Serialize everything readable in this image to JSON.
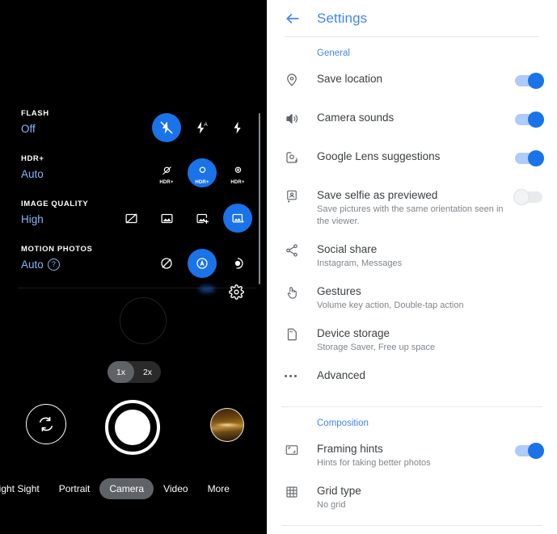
{
  "camera": {
    "quick_settings": [
      {
        "title": "FLASH",
        "value": "Off",
        "help": false,
        "options": [
          {
            "icon": "flash-off-icon",
            "selected": true,
            "sublabel": ""
          },
          {
            "icon": "flash-auto-icon",
            "selected": false,
            "sublabel": ""
          },
          {
            "icon": "flash-on-icon",
            "selected": false,
            "sublabel": ""
          }
        ]
      },
      {
        "title": "HDR+",
        "value": "Auto",
        "help": false,
        "options": [
          {
            "icon": "hdr-off-icon",
            "selected": false,
            "sublabel": "HDR+"
          },
          {
            "icon": "hdr-auto-icon",
            "selected": true,
            "sublabel": "HDR+"
          },
          {
            "icon": "hdr-enhanced-icon",
            "selected": false,
            "sublabel": "HDR+"
          }
        ]
      },
      {
        "title": "IMAGE QUALITY",
        "value": "High",
        "help": false,
        "options": [
          {
            "icon": "image-off-icon",
            "selected": false,
            "sublabel": ""
          },
          {
            "icon": "image-basic-icon",
            "selected": false,
            "sublabel": ""
          },
          {
            "icon": "image-plus-icon",
            "selected": false,
            "sublabel": ""
          },
          {
            "icon": "image-high-icon",
            "selected": true,
            "sublabel": ""
          }
        ]
      },
      {
        "title": "MOTION PHOTOS",
        "value": "Auto",
        "help": true,
        "help_glyph": "?",
        "options": [
          {
            "icon": "motion-off-icon",
            "selected": false,
            "sublabel": ""
          },
          {
            "icon": "motion-auto-icon",
            "selected": true,
            "sublabel": ""
          },
          {
            "icon": "motion-on-icon",
            "selected": false,
            "sublabel": ""
          }
        ]
      }
    ],
    "gear_icon": "settings-gear-icon",
    "zoom": {
      "options": [
        "1x",
        "2x"
      ],
      "selected": "1x"
    },
    "flip_icon": "switch-camera-icon",
    "shutter_label": "shutter-button",
    "thumbnail_label": "last-photo-thumbnail",
    "modes": [
      {
        "label": "Night Sight",
        "active": false,
        "clipped": true
      },
      {
        "label": "Portrait",
        "active": false,
        "clipped": false
      },
      {
        "label": "Camera",
        "active": true,
        "clipped": false
      },
      {
        "label": "Video",
        "active": false,
        "clipped": false
      },
      {
        "label": "More",
        "active": false,
        "clipped": false
      }
    ]
  },
  "settings": {
    "back_icon": "back-arrow-icon",
    "title": "Settings",
    "sections": [
      {
        "label": "General",
        "rows": [
          {
            "icon": "location-pin-icon",
            "title": "Save location",
            "sub": "",
            "toggle": "on"
          },
          {
            "icon": "volume-up-icon",
            "title": "Camera sounds",
            "sub": "",
            "toggle": "on"
          },
          {
            "icon": "google-lens-icon",
            "title": "Google Lens suggestions",
            "sub": "",
            "toggle": "on"
          },
          {
            "icon": "selfie-flip-icon",
            "title": "Save selfie as previewed",
            "sub": "Save pictures with the same orientation seen in the viewer.",
            "toggle": "off"
          },
          {
            "icon": "share-icon",
            "title": "Social share",
            "sub": "Instagram, Messages",
            "toggle": "none"
          },
          {
            "icon": "gesture-tap-icon",
            "title": "Gestures",
            "sub": "Volume key action, Double-tap action",
            "toggle": "none"
          },
          {
            "icon": "sd-card-icon",
            "title": "Device storage",
            "sub": "Storage Saver, Free up space",
            "toggle": "none"
          },
          {
            "icon": "more-horiz-icon",
            "title": "Advanced",
            "sub": "",
            "toggle": "none"
          }
        ]
      },
      {
        "label": "Composition",
        "rows": [
          {
            "icon": "framing-hints-icon",
            "title": "Framing hints",
            "sub": "Hints for taking better photos",
            "toggle": "on"
          },
          {
            "icon": "grid-icon",
            "title": "Grid type",
            "sub": "No grid",
            "toggle": "none"
          }
        ]
      }
    ]
  },
  "colors": {
    "accent_blue": "#1a73e8",
    "link_blue": "#4285f4",
    "camera_value_blue": "#8ab4f8",
    "toggle_track_on": "#aecbfa",
    "background_dark": "#000000",
    "background_light": "#ffffff"
  }
}
